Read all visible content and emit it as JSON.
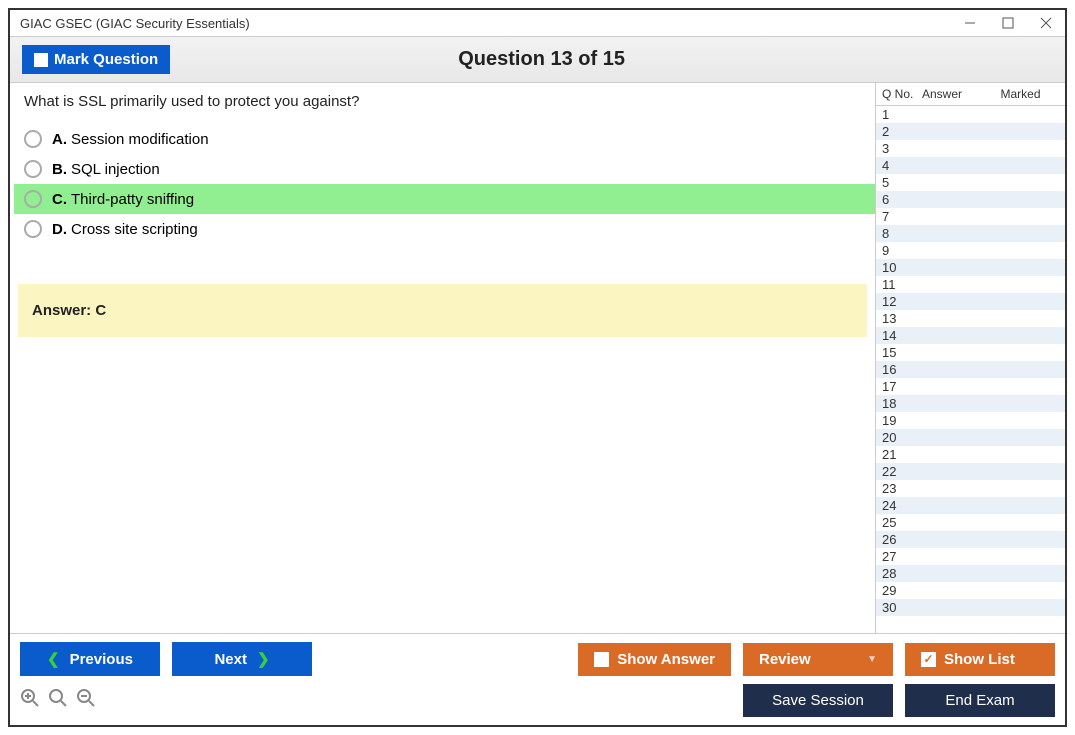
{
  "window": {
    "title": "GIAC GSEC (GIAC Security Essentials)"
  },
  "header": {
    "mark_label": "Mark Question",
    "counter": "Question 13 of 15"
  },
  "question": {
    "text": "What is SSL primarily used to protect you against?",
    "options": [
      {
        "letter": "A.",
        "text": "Session modification",
        "selected": false
      },
      {
        "letter": "B.",
        "text": "SQL injection",
        "selected": false
      },
      {
        "letter": "C.",
        "text": "Third-patty sniffing",
        "selected": true
      },
      {
        "letter": "D.",
        "text": "Cross site scripting",
        "selected": false
      }
    ],
    "answer_label": "Answer: C"
  },
  "sidebar": {
    "headers": {
      "qno": "Q No.",
      "answer": "Answer",
      "marked": "Marked"
    },
    "rows": [
      1,
      2,
      3,
      4,
      5,
      6,
      7,
      8,
      9,
      10,
      11,
      12,
      13,
      14,
      15,
      16,
      17,
      18,
      19,
      20,
      21,
      22,
      23,
      24,
      25,
      26,
      27,
      28,
      29,
      30
    ]
  },
  "footer": {
    "previous": "Previous",
    "next": "Next",
    "show_answer": "Show Answer",
    "review": "Review",
    "show_list": "Show List",
    "save_session": "Save Session",
    "end_exam": "End Exam"
  }
}
